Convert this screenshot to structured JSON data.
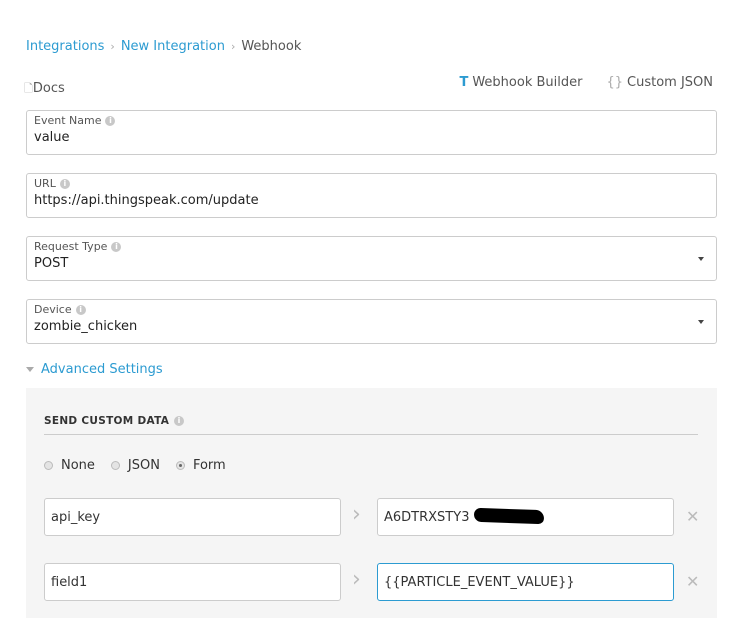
{
  "breadcrumb": {
    "items": [
      "Integrations",
      "New Integration"
    ],
    "current": "Webhook"
  },
  "docs_label": "Docs",
  "tabs": {
    "builder": "Webhook Builder",
    "builder_icon": "T",
    "custom": "Custom JSON",
    "custom_icon": "{}"
  },
  "fields": [
    {
      "label": "Event Name",
      "value": "value"
    },
    {
      "label": "URL",
      "value": "https://api.thingspeak.com/update"
    },
    {
      "label": "Request Type",
      "value": "POST"
    },
    {
      "label": "Device",
      "value": "zombie_chicken"
    }
  ],
  "advanced": {
    "label": "Advanced Settings",
    "section_title": "SEND CUSTOM DATA",
    "radios": [
      {
        "label": "None",
        "checked": false
      },
      {
        "label": "JSON",
        "checked": false
      },
      {
        "label": "Form",
        "checked": true
      }
    ],
    "rows": [
      {
        "key": "api_key",
        "value": "A6DTRXSTY3",
        "value_redacted": true
      },
      {
        "key": "field1",
        "value": "{{PARTICLE_EVENT_VALUE}}"
      }
    ]
  },
  "colors": {
    "accent": "#2c9bd1",
    "panel": "#f5f5f5"
  }
}
